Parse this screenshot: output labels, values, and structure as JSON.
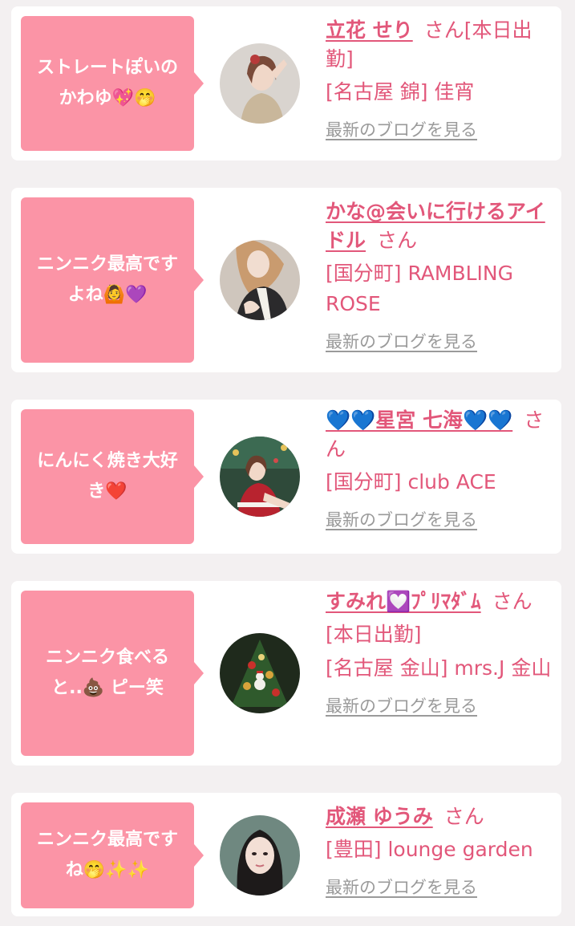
{
  "cards": [
    {
      "comment": "ストレートぽいの\nかわゆ💖🤭",
      "name": "立花 せり",
      "honorific": "さん[本日出勤]",
      "shop": "[名古屋 錦] 佳宵",
      "blog_link": "最新のブログを見る",
      "avatar": "woman-portrait-icon"
    },
    {
      "comment": "ニンニク最高です\nよね🙆💜",
      "name": "かな@会いに行けるアイドル",
      "honorific": "さん",
      "shop": "[国分町] RAMBLING ROSE",
      "blog_link": "最新のブログを見る",
      "avatar": "woman-portrait-icon"
    },
    {
      "comment": "にんにく焼き大好\nき❤️",
      "name": "💙💙星宮 七海💙💙",
      "honorific": "さん",
      "shop": "[国分町] club ACE",
      "blog_link": "最新のブログを見る",
      "avatar": "christmas-portrait-icon"
    },
    {
      "comment": "ニンニク食べる\nと..💩 ピー笑",
      "name": "すみれ💟ﾌﾟﾘﾏﾀﾞﾑ",
      "honorific": "さん",
      "status": "[本日出勤]",
      "shop": "[名古屋 金山] mrs.J 金山",
      "blog_link": "最新のブログを見る",
      "avatar": "christmas-tree-icon"
    },
    {
      "comment": "ニンニク最高です\nね🤭✨✨",
      "name": "成瀬 ゆうみ",
      "honorific": "さん",
      "shop": "[豊田] lounge garden",
      "blog_link": "最新のブログを見る",
      "avatar": "woman-portrait-icon"
    }
  ],
  "colors": {
    "bubble": "#fb94a6",
    "name": "#e2577a",
    "blog_link": "#9a9a9a",
    "background": "#f3f0f1"
  }
}
